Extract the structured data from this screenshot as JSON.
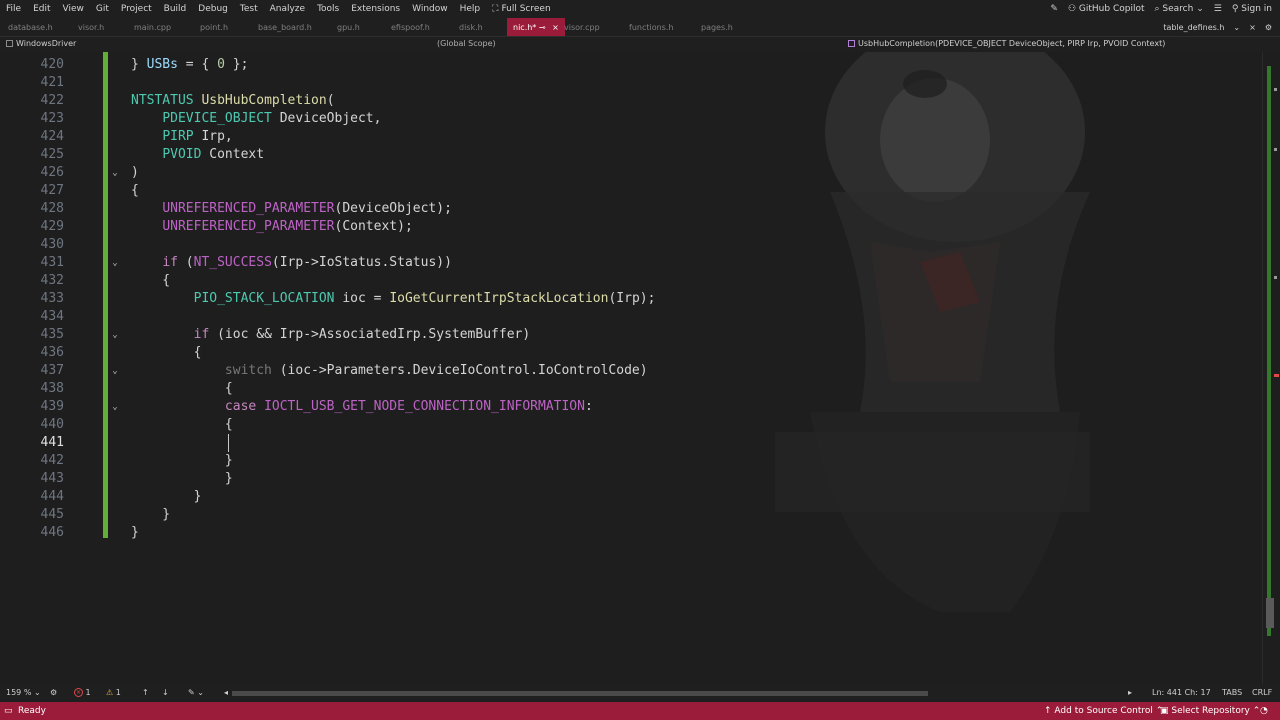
{
  "menu": {
    "items": [
      "File",
      "Edit",
      "View",
      "Git",
      "Project",
      "Build",
      "Debug",
      "Test",
      "Analyze",
      "Tools",
      "Extensions",
      "Window",
      "Help"
    ],
    "fullscreen": "Full Screen",
    "copilot": "GitHub Copilot",
    "search": "Search",
    "signin": "Sign in"
  },
  "tabs": {
    "items": [
      "database.h",
      "visor.h",
      "main.cpp",
      "point.h",
      "base_board.h",
      "gpu.h",
      "efispoof.h",
      "disk.h",
      "nic.h*",
      "visor.cpp",
      "functions.h",
      "pages.h"
    ],
    "active_index": 8,
    "pinned_right": "table_defines.h",
    "close_glyph": "×"
  },
  "navbar": {
    "project": "WindowsDriver",
    "scope": "(Global Scope)",
    "function": "UsbHubCompletion(PDEVICE_OBJECT DeviceObject, PIRP Irp, PVOID Context)"
  },
  "editor": {
    "current_line": 441,
    "lines": [
      {
        "n": 420,
        "text": "} USBs = { 0 };"
      },
      {
        "n": 421,
        "text": ""
      },
      {
        "n": 422,
        "text": "NTSTATUS UsbHubCompletion("
      },
      {
        "n": 423,
        "text": "    PDEVICE_OBJECT DeviceObject,"
      },
      {
        "n": 424,
        "text": "    PIRP Irp,"
      },
      {
        "n": 425,
        "text": "    PVOID Context"
      },
      {
        "n": 426,
        "text": ")"
      },
      {
        "n": 427,
        "text": "{"
      },
      {
        "n": 428,
        "text": "    UNREFERENCED_PARAMETER(DeviceObject);"
      },
      {
        "n": 429,
        "text": "    UNREFERENCED_PARAMETER(Context);"
      },
      {
        "n": 430,
        "text": ""
      },
      {
        "n": 431,
        "text": "    if (NT_SUCCESS(Irp->IoStatus.Status))"
      },
      {
        "n": 432,
        "text": "    {"
      },
      {
        "n": 433,
        "text": "        PIO_STACK_LOCATION ioc = IoGetCurrentIrpStackLocation(Irp);"
      },
      {
        "n": 434,
        "text": ""
      },
      {
        "n": 435,
        "text": "        if (ioc && Irp->AssociatedIrp.SystemBuffer)"
      },
      {
        "n": 436,
        "text": "        {"
      },
      {
        "n": 437,
        "text": "            switch (ioc->Parameters.DeviceIoControl.IoControlCode)"
      },
      {
        "n": 438,
        "text": "            {"
      },
      {
        "n": 439,
        "text": "            case IOCTL_USB_GET_NODE_CONNECTION_INFORMATION:"
      },
      {
        "n": 440,
        "text": "            {"
      },
      {
        "n": 441,
        "text": ""
      },
      {
        "n": 442,
        "text": "            }"
      },
      {
        "n": 443,
        "text": "            }"
      },
      {
        "n": 444,
        "text": "        }"
      },
      {
        "n": 445,
        "text": "    }"
      },
      {
        "n": 446,
        "text": "}"
      }
    ]
  },
  "infobar": {
    "zoom": "159 %",
    "errors": "1",
    "warnings": "1",
    "position": "Ln: 441   Ch: 17",
    "tabs": "TABS",
    "eol": "CRLF"
  },
  "status": {
    "ready": "Ready",
    "source_control": "Add to Source Control",
    "repository": "Select Repository"
  },
  "colors": {
    "accent": "#9b1b3a",
    "change_bar": "#5fb034",
    "type": "#4ec9b0",
    "function": "#dcdcaa",
    "keyword": "#c586c0"
  }
}
